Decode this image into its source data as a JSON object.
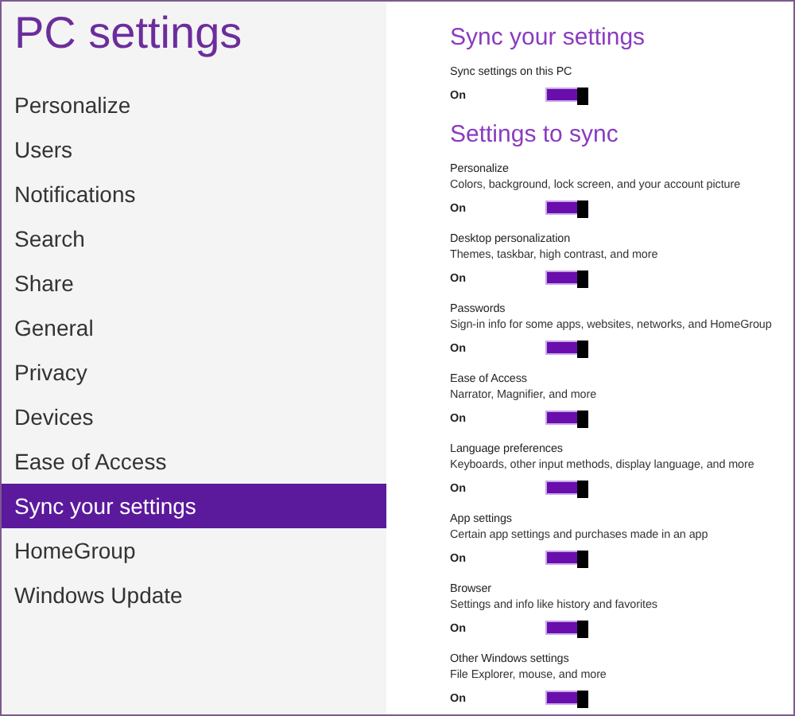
{
  "title": "PC settings",
  "nav": [
    {
      "label": "Personalize",
      "selected": false
    },
    {
      "label": "Users",
      "selected": false
    },
    {
      "label": "Notifications",
      "selected": false
    },
    {
      "label": "Search",
      "selected": false
    },
    {
      "label": "Share",
      "selected": false
    },
    {
      "label": "General",
      "selected": false
    },
    {
      "label": "Privacy",
      "selected": false
    },
    {
      "label": "Devices",
      "selected": false
    },
    {
      "label": "Ease of Access",
      "selected": false
    },
    {
      "label": "Sync your settings",
      "selected": true
    },
    {
      "label": "HomeGroup",
      "selected": false
    },
    {
      "label": "Windows Update",
      "selected": false
    }
  ],
  "sections": [
    {
      "heading": "Sync your settings",
      "settings": [
        {
          "name": "Sync settings on this PC",
          "state": "On",
          "on": true
        }
      ]
    },
    {
      "heading": "Settings to sync",
      "settings": [
        {
          "name": "Personalize",
          "description": "Colors, background, lock screen, and your account picture",
          "state": "On",
          "on": true
        },
        {
          "name": "Desktop personalization",
          "description": "Themes, taskbar, high contrast, and more",
          "state": "On",
          "on": true
        },
        {
          "name": "Passwords",
          "description": "Sign-in info for some apps, websites, networks, and HomeGroup",
          "state": "On",
          "on": true
        },
        {
          "name": "Ease of Access",
          "description": "Narrator, Magnifier, and more",
          "state": "On",
          "on": true
        },
        {
          "name": "Language preferences",
          "description": "Keyboards, other input methods, display language, and more",
          "state": "On",
          "on": true
        },
        {
          "name": "App settings",
          "description": "Certain app settings and purchases made in an app",
          "state": "On",
          "on": true
        },
        {
          "name": "Browser",
          "description": "Settings and info like history and favorites",
          "state": "On",
          "on": true
        },
        {
          "name": "Other Windows settings",
          "description": "File Explorer, mouse, and more",
          "state": "On",
          "on": true
        }
      ]
    }
  ]
}
